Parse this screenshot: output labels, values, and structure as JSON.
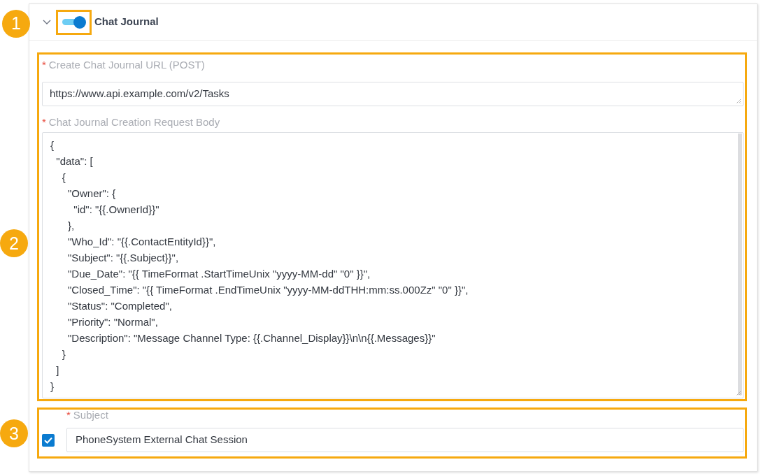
{
  "callouts": [
    {
      "number": "1"
    },
    {
      "number": "2"
    },
    {
      "number": "3"
    }
  ],
  "section": {
    "title": "Chat Journal",
    "expanded": true,
    "enabled": true
  },
  "url_field": {
    "required_mark": "*",
    "label": "Create Chat Journal URL (POST)",
    "value": "https://www.api.example.com/v2/Tasks"
  },
  "body_field": {
    "required_mark": "*",
    "label": "Chat Journal Creation Request Body",
    "lines": [
      "{",
      "  \"data\": [",
      "    {",
      "      \"Owner\": {",
      "        \"id\": \"{{.OwnerId}}\"",
      "      },",
      "      \"Who_Id\": \"{{.ContactEntityId}}\",",
      "      \"Subject\": \"{{.Subject}}\",",
      "      \"Due_Date\": \"{{ TimeFormat .StartTimeUnix \"yyyy-MM-dd\" \"0\" }}\",",
      "      \"Closed_Time\": \"{{ TimeFormat .EndTimeUnix \"yyyy-MM-ddTHH:mm:ss.000Zz\" \"0\" }}\",",
      "      \"Status\": \"Completed\",",
      "      \"Priority\": \"Normal\",",
      "      \"Description\": \"Message Channel Type: {{.Channel_Display}}\\n\\n{{.Messages}}\"",
      "    }",
      "  ]",
      "}"
    ]
  },
  "subject_field": {
    "required_mark": "*",
    "label": "Subject",
    "checked": true,
    "value": "PhoneSystem External Chat Session"
  }
}
